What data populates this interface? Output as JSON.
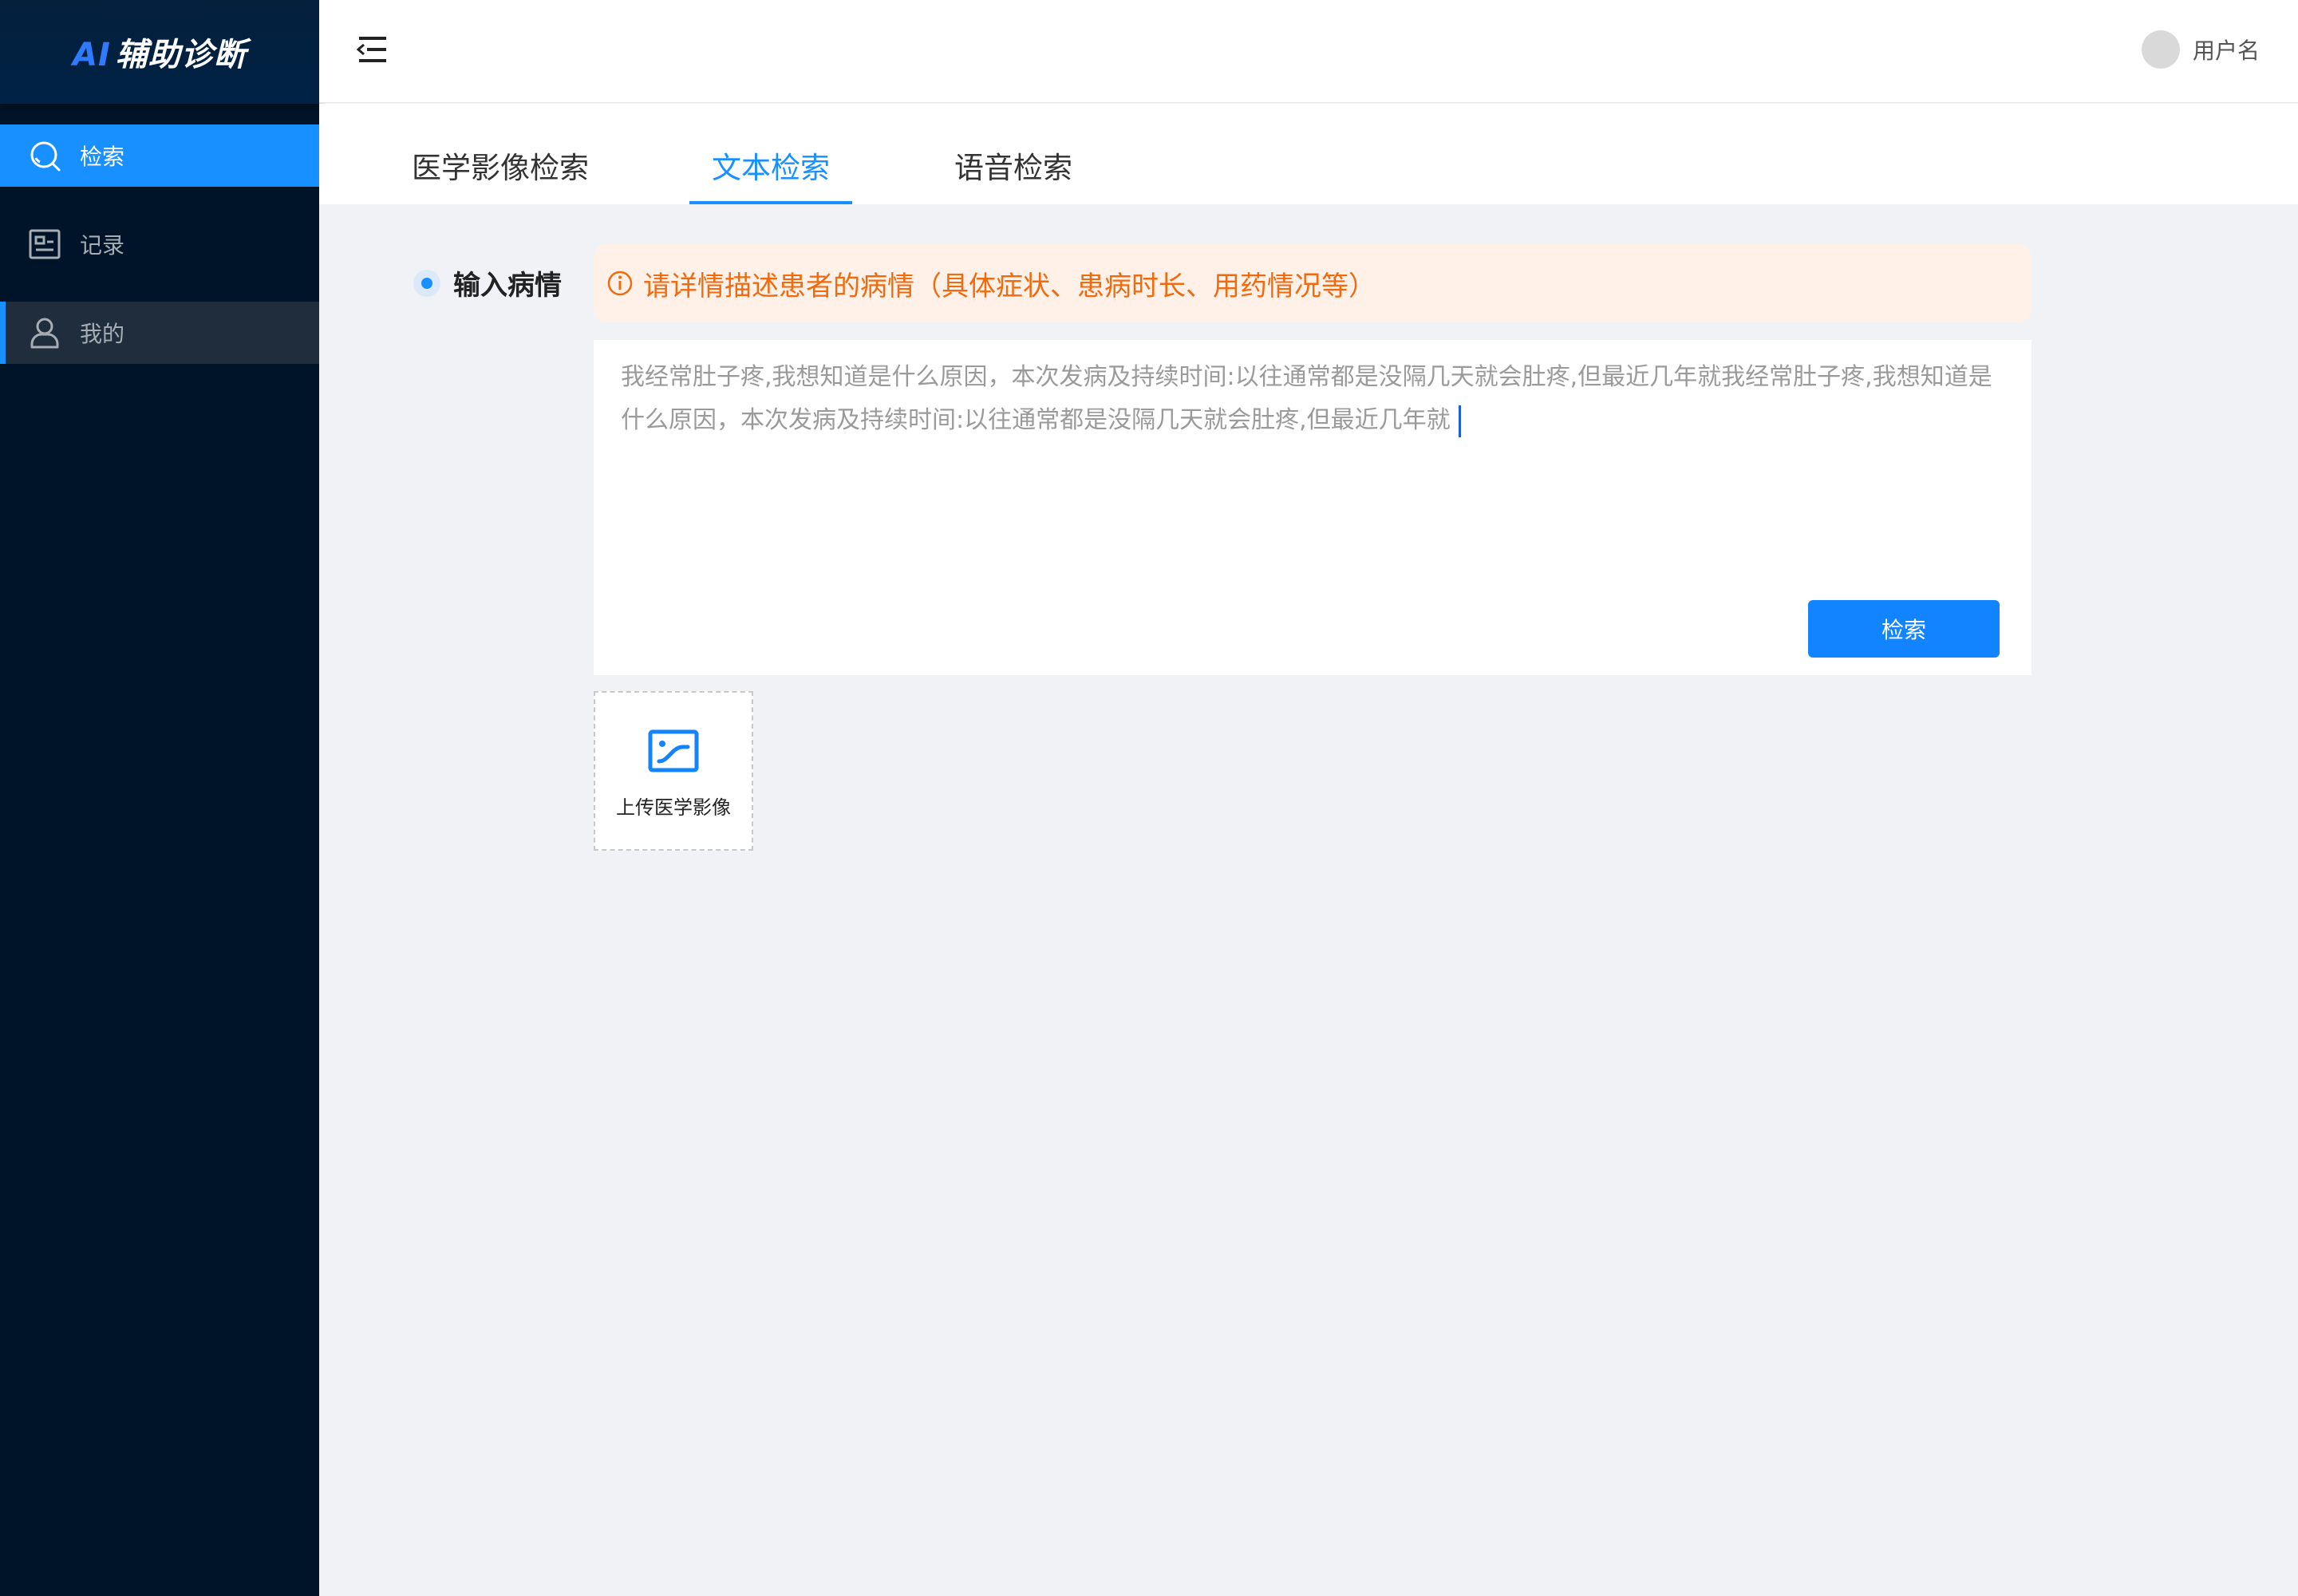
{
  "app": {
    "logo_prefix": "AI",
    "logo_text": "辅助诊断"
  },
  "sidebar": {
    "items": [
      {
        "label": "检索",
        "icon": "search-icon",
        "state": "active"
      },
      {
        "label": "记录",
        "icon": "record-icon",
        "state": "normal"
      },
      {
        "label": "我的",
        "icon": "user-icon",
        "state": "hover"
      }
    ]
  },
  "header": {
    "menu_toggle_icon": "menu-fold-icon",
    "username": "用户名"
  },
  "tabs": [
    {
      "label": "医学影像检索",
      "active": false
    },
    {
      "label": "文本检索",
      "active": true
    },
    {
      "label": "语音检索",
      "active": false
    }
  ],
  "form": {
    "section_label": "输入病情",
    "hint_icon": "info-circle-icon",
    "hint": "请详情描述患者的病情（具体症状、患病时长、用药情况等）",
    "textarea_value": "我经常肚子疼,我想知道是什么原因，本次发病及持续时间:以往通常都是没隔几天就会肚疼,但最近几年就我经常肚子疼,我想知道是什么原因，本次发病及持续时间:以往通常都是没隔几天就会肚疼,但最近几年就",
    "search_button": "检索",
    "upload_icon": "image-icon",
    "upload_label": "上传医学影像"
  },
  "colors": {
    "sidebar_bg": "#001429",
    "primary": "#1890ff",
    "hint_text": "#f06a0f",
    "hint_bg": "#fff1e8",
    "page_bg": "#f0f2f5"
  }
}
